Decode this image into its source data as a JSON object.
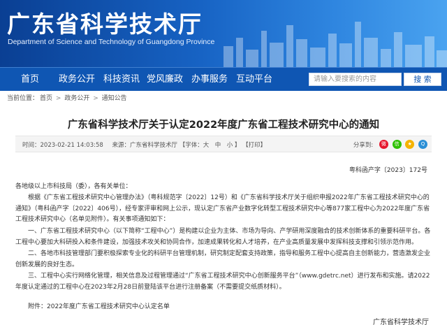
{
  "header": {
    "title": "广东省科学技术厅",
    "subtitle": "Department of Science and Technology of Guangdong Province"
  },
  "nav": {
    "items": [
      "首页",
      "政务公开",
      "科技资讯",
      "党风廉政",
      "办事服务",
      "互动平台"
    ],
    "search_placeholder": "请输入要搜索的内容",
    "search_button": "搜 索"
  },
  "breadcrumb": {
    "prefix": "当前位置：",
    "items": [
      "首页",
      "政务公开",
      "通知公告"
    ],
    "separator": ">"
  },
  "article": {
    "title": "广东省科学技术厅关于认定2022年度广东省工程技术研究中心的通知",
    "meta": {
      "time": "时间：2023-02-21 14:03:58",
      "source": "来源：广东省科学技术厅",
      "font_size": "【字体：大　中　小 】",
      "print": "【打印】"
    },
    "share_label": "分享到:",
    "share_icons": [
      "weibo-icon",
      "wechat-icon",
      "qzone-icon",
      "qq-icon"
    ],
    "doc_number": "粤科函产字〔2023〕172号",
    "paragraphs": [
      "各地级以上市科技局（委），各有关单位：",
      "根据《广东省工程技术研究中心管理办法》（粤科规范字〔2022〕12号）和《广东省科学技术厅关于组织申报2022年广东省工程技术研究中心的通知》（粤科函产字〔2022〕406号），经专家评审和网上公示，现认定广东省产业数字化转型工程技术研究中心等877家工程中心为2022年度广东省工程技术研究中心（名单见附件）。有关事项通知如下：",
      "一、广东省工程技术研究中心（以下简称“工程中心”）是构建以企业为主体、市场为导向、产学研用深度融合的技术创新体系的重要科研平台。各工程中心要加大科研投入和条件建设，加强技术攻关和协同合作，加速成果转化和人才培养，在产业高质量发展中发挥科技支撑和引领示范作用。",
      "二、各地市科技管理部门要积极探索专业化的科研平台管理机制，研究制定配套支持政策，指导和服务工程中心提高自主创新能力，营造激发企业创新发展的良好生态。",
      "三、工程中心实行网络化管理，相关信息及过程管理通过“广东省工程技术研究中心创新服务平台”（www.gdetrc.net）进行发布和实施。请2022年度认定通过的工程中心在2023年2月28日前登陆该平台进行注册备案（不需要提交纸质材料）。",
      "附件：2022年度广东省工程技术研究中心认定名单"
    ],
    "signature": "广东省科学技术厅"
  },
  "colors": {
    "banner": "#0a3f93",
    "nav": "#0f56b3"
  }
}
